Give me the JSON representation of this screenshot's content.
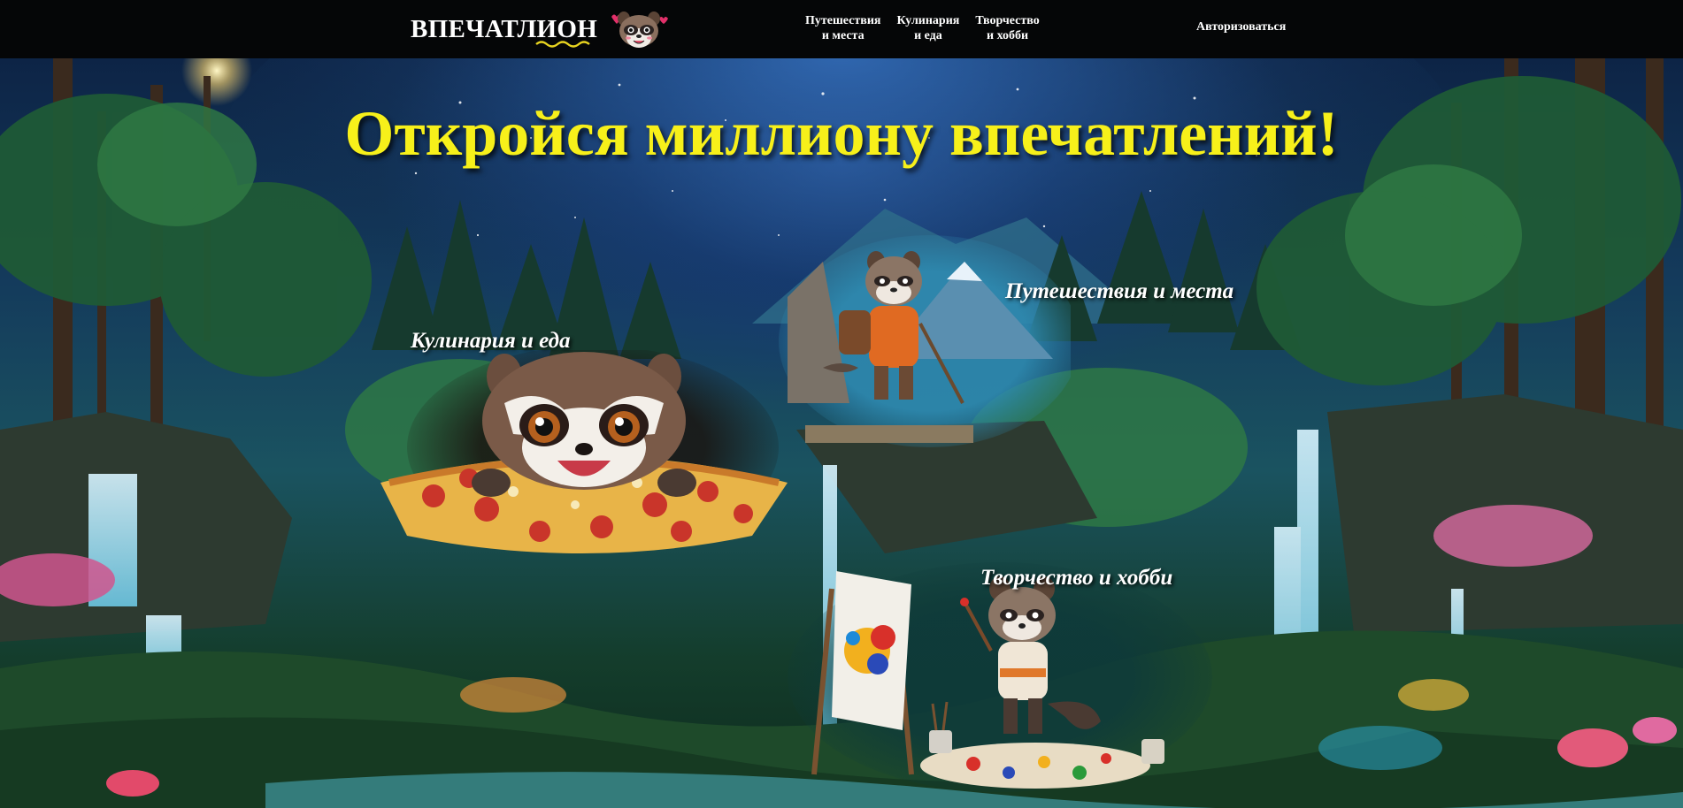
{
  "header": {
    "logo_text": "ВПЕЧАТЛИОН",
    "nav": [
      {
        "label": "Путешествия\nи места"
      },
      {
        "label": "Кулинария\nи еда"
      },
      {
        "label": "Творчество\nи хобби"
      }
    ],
    "login_label": "Авторизоваться"
  },
  "hero": {
    "headline": "Откройся миллиону впечатлений!",
    "cards": [
      {
        "label": "Путешествия и места",
        "icon": "hiking-raccoon"
      },
      {
        "label": "Кулинария и еда",
        "icon": "pizza-raccoon"
      },
      {
        "label": "Творчество и хобби",
        "icon": "painter-raccoon"
      }
    ]
  },
  "colors": {
    "header_bg": "#050607",
    "headline": "#f7f01a",
    "squiggle": "#e8d420",
    "nav_text": "#ffffff"
  }
}
